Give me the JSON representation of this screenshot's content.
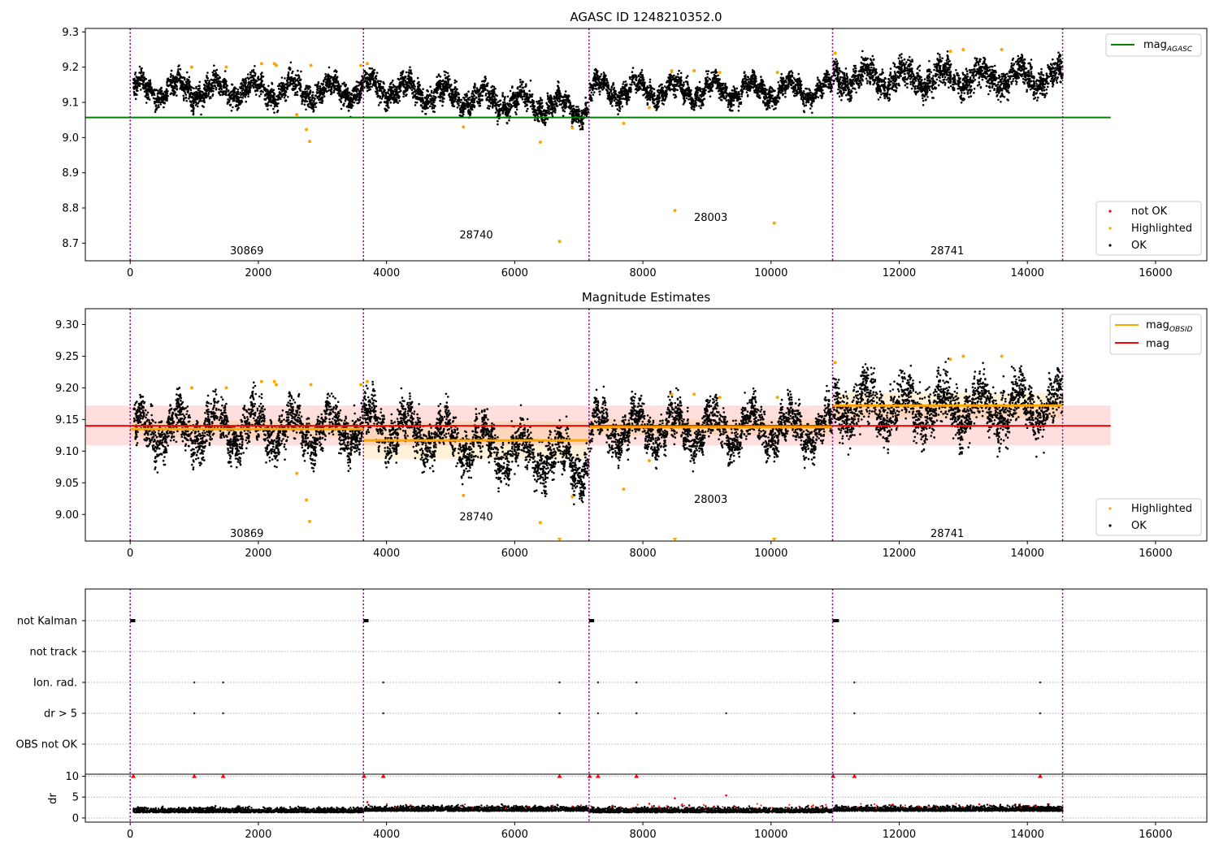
{
  "chart_data": [
    {
      "type": "scatter",
      "title": "AGASC ID 1248210352.0",
      "xlim": [
        -700,
        16800
      ],
      "ylim": [
        8.65,
        9.31
      ],
      "xticks": [
        0,
        2000,
        4000,
        6000,
        8000,
        10000,
        12000,
        14000,
        16000
      ],
      "yticks": [
        8.7,
        8.8,
        8.9,
        9.0,
        9.1,
        9.2,
        9.3
      ],
      "legend_upper": {
        "position": "top-right",
        "entries": [
          "mag_AGASC"
        ]
      },
      "legend_lower": {
        "position": "bottom-right",
        "entries": [
          "not OK",
          "Highlighted",
          "OK"
        ]
      },
      "mag_agasc": 9.057,
      "mag_agasc_xrange": [
        -700,
        15300
      ],
      "obsid_boundaries": [
        0,
        3640,
        7160,
        10960,
        14550
      ],
      "obsid_labels": [
        {
          "text": "30869",
          "x": 1820,
          "y": 8.68
        },
        {
          "text": "28740",
          "x": 5400,
          "y": 8.725
        },
        {
          "text": "28003",
          "x": 9060,
          "y": 8.775
        },
        {
          "text": "28741",
          "x": 12750,
          "y": 8.68
        }
      ],
      "ok_segments": [
        {
          "x0": 50,
          "x1": 3640,
          "center": 9.135,
          "spread": 0.045
        },
        {
          "x0": 3650,
          "x1": 7150,
          "trend": [
            9.145,
            9.08
          ],
          "spread": 0.045
        },
        {
          "x0": 7170,
          "x1": 10950,
          "center": 9.135,
          "spread": 0.04
        },
        {
          "x0": 10970,
          "x1": 14550,
          "center": 9.17,
          "spread": 0.055
        }
      ],
      "highlighted": [
        [
          960,
          9.2
        ],
        [
          1500,
          9.2
        ],
        [
          2050,
          9.21
        ],
        [
          2250,
          9.21
        ],
        [
          2280,
          9.205
        ],
        [
          2600,
          9.065
        ],
        [
          2750,
          9.023
        ],
        [
          2800,
          8.989
        ],
        [
          2820,
          9.205
        ],
        [
          3600,
          9.205
        ],
        [
          3700,
          9.21
        ],
        [
          5200,
          9.03
        ],
        [
          6400,
          8.987
        ],
        [
          6700,
          8.705
        ],
        [
          6900,
          9.028
        ],
        [
          7700,
          9.04
        ],
        [
          8100,
          9.085
        ],
        [
          8450,
          9.19
        ],
        [
          8500,
          8.793
        ],
        [
          8800,
          9.19
        ],
        [
          9200,
          9.185
        ],
        [
          10050,
          8.757
        ],
        [
          10100,
          9.185
        ],
        [
          11000,
          9.24
        ],
        [
          12800,
          9.245
        ],
        [
          13000,
          9.25
        ],
        [
          13600,
          9.25
        ]
      ]
    },
    {
      "type": "scatter",
      "title": "Magnitude Estimates",
      "xlim": [
        -700,
        16800
      ],
      "ylim": [
        8.958,
        9.325
      ],
      "xticks": [
        0,
        2000,
        4000,
        6000,
        8000,
        10000,
        12000,
        14000,
        16000
      ],
      "yticks": [
        9.0,
        9.05,
        9.1,
        9.15,
        9.2,
        9.25,
        9.3
      ],
      "legend_upper": {
        "position": "top-right",
        "entries": [
          "mag_OBSID",
          "mag"
        ]
      },
      "legend_lower": {
        "position": "bottom-right",
        "entries": [
          "Highlighted",
          "OK"
        ]
      },
      "mag": 9.14,
      "mag_band": [
        9.109,
        9.172
      ],
      "mag_xrange": [
        -700,
        15300
      ],
      "mag_obsid": [
        {
          "x0": 0,
          "x1": 3640,
          "mag": 9.135,
          "band": [
            9.122,
            9.148
          ]
        },
        {
          "x0": 3640,
          "x1": 7160,
          "mag": 9.117,
          "band": [
            9.087,
            9.147
          ]
        },
        {
          "x0": 7160,
          "x1": 10960,
          "mag": 9.138,
          "band": [
            9.125,
            9.15
          ]
        },
        {
          "x0": 10960,
          "x1": 14550,
          "mag": 9.172,
          "band": [
            9.152,
            9.192
          ]
        }
      ],
      "obsid_boundaries": [
        0,
        3640,
        7160,
        10960,
        14550
      ],
      "obsid_labels": [
        {
          "text": "30869",
          "x": 1820,
          "y": 8.971
        },
        {
          "text": "28740",
          "x": 5400,
          "y": 8.997
        },
        {
          "text": "28003",
          "x": 9060,
          "y": 9.025
        },
        {
          "text": "28741",
          "x": 12750,
          "y": 8.971
        }
      ],
      "ok_segments": [
        {
          "x0": 50,
          "x1": 3640,
          "center": 9.135,
          "spread": 0.045
        },
        {
          "x0": 3650,
          "x1": 7150,
          "trend": [
            9.145,
            9.08
          ],
          "spread": 0.045
        },
        {
          "x0": 7170,
          "x1": 10950,
          "center": 9.135,
          "spread": 0.04
        },
        {
          "x0": 10970,
          "x1": 14550,
          "center": 9.17,
          "spread": 0.055
        }
      ],
      "highlighted": [
        [
          960,
          9.2
        ],
        [
          1500,
          9.2
        ],
        [
          2050,
          9.21
        ],
        [
          2250,
          9.21
        ],
        [
          2280,
          9.205
        ],
        [
          2600,
          9.065
        ],
        [
          2750,
          9.023
        ],
        [
          2800,
          8.989
        ],
        [
          2820,
          9.205
        ],
        [
          3600,
          9.205
        ],
        [
          3700,
          9.21
        ],
        [
          5200,
          9.03
        ],
        [
          6400,
          8.987
        ],
        [
          6900,
          9.028
        ],
        [
          7700,
          9.04
        ],
        [
          8100,
          9.085
        ],
        [
          8450,
          9.19
        ],
        [
          8800,
          9.19
        ],
        [
          9200,
          9.185
        ],
        [
          10100,
          9.185
        ],
        [
          11000,
          9.24
        ],
        [
          12800,
          9.245
        ],
        [
          13000,
          9.25
        ],
        [
          13600,
          9.25
        ]
      ],
      "clipped_highlighted_x": [
        6700,
        8500,
        10050
      ]
    },
    {
      "type": "scatter",
      "title": "",
      "xlim": [
        -700,
        16800
      ],
      "xticks": [
        0,
        2000,
        4000,
        6000,
        8000,
        10000,
        12000,
        14000,
        16000
      ],
      "flag_rows": [
        "not Kalman",
        "not track",
        "Ion. rad.",
        "dr > 5",
        "OBS not OK"
      ],
      "flags": {
        "not Kalman": [
          [
            0,
            80
          ],
          [
            3640,
            3720
          ],
          [
            7160,
            7240
          ],
          [
            10960,
            11060
          ]
        ],
        "not track": [],
        "Ion. rad.": [
          1000,
          1450,
          3950,
          6700,
          7300,
          7900,
          11300,
          14200
        ],
        "dr > 5": [
          1000,
          1450,
          3950,
          6700,
          7300,
          7900,
          9300,
          11300,
          14200
        ],
        "OBS not OK": []
      },
      "obsid_boundaries": [
        0,
        3640,
        7160,
        10960,
        14550
      ],
      "dr_ylabel": "dr",
      "dr_yticks": [
        0,
        5,
        10
      ],
      "dr_ylim": [
        -1,
        10.5
      ],
      "dr_capped": [
        50,
        3650,
        7170,
        10970,
        1000,
        1450,
        3950,
        6700,
        7300,
        7900,
        11300,
        14200
      ],
      "dr_outliers": [
        [
          8100,
          3.4
        ],
        [
          8500,
          4.7
        ],
        [
          9300,
          5.4
        ],
        [
          3700,
          3.8
        ],
        [
          11900,
          3.2
        ],
        [
          13250,
          3.3
        ]
      ]
    }
  ]
}
